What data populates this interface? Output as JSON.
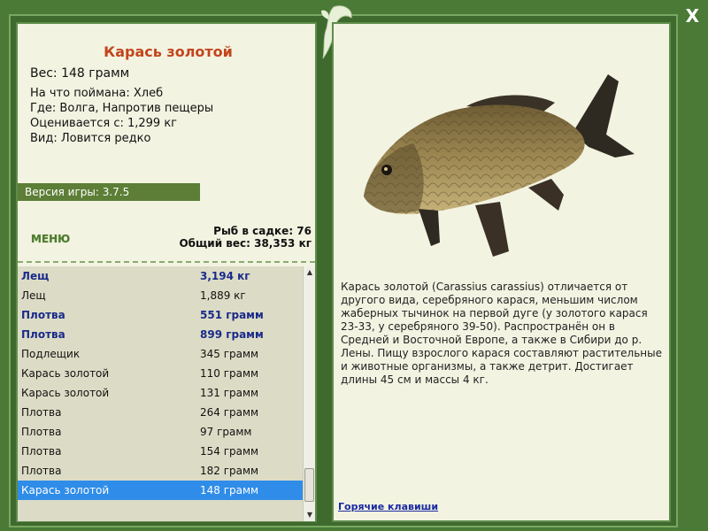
{
  "close_label": "X",
  "fish": {
    "title": "Карась золотой",
    "weight_line": "Вес: 148 грамм",
    "bait_line": "На что поймана: Хлеб",
    "place_line": "Где: Волга, Напротив пещеры",
    "price_line": "Оценивается с: 1,299 кг",
    "kind_line": "Вид: Ловится редко"
  },
  "version_label": "Версия игры: 3.7.5",
  "menu_label": "МЕНЮ",
  "cage": {
    "count_line": "Рыб в садке: 76",
    "total_line": "Общий вес: 38,353 кг"
  },
  "catch_list": [
    {
      "name": "Лещ",
      "weight": "3,194 кг",
      "bold": true
    },
    {
      "name": "Лещ",
      "weight": "1,889 кг",
      "bold": false
    },
    {
      "name": "Плотва",
      "weight": "551 грамм",
      "bold": true
    },
    {
      "name": "Плотва",
      "weight": "899 грамм",
      "bold": true
    },
    {
      "name": "Подлещик",
      "weight": "345 грамм",
      "bold": false
    },
    {
      "name": "Карась золотой",
      "weight": "110 грамм",
      "bold": false
    },
    {
      "name": "Карась золотой",
      "weight": "131 грамм",
      "bold": false
    },
    {
      "name": "Плотва",
      "weight": "264 грамм",
      "bold": false
    },
    {
      "name": "Плотва",
      "weight": "97 грамм",
      "bold": false
    },
    {
      "name": "Плотва",
      "weight": "154 грамм",
      "bold": false
    },
    {
      "name": "Плотва",
      "weight": "182 грамм",
      "bold": false
    },
    {
      "name": "Карась золотой",
      "weight": "148 грамм",
      "bold": false,
      "selected": true
    }
  ],
  "description": "Карась золотой (Carassius carassius) отличается от другого вида, серебряного карася, меньшим числом жаберных тычинок на первой дуге (у золотого карася 23-33, у серебряного 39-50). Распространён он в Средней и Восточной Европе, а также в Сибири до р. Лены. Пищу взрослого карася составляют растительные и животные организмы, а также детрит. Достигает длины 45 см и массы 4 кг.",
  "hotkeys_label": "Горячие клавиши",
  "colors": {
    "frame": "#4a7a35",
    "panel": "#f3f3e2",
    "title": "#c2451b",
    "list_bg": "#dcdcc6",
    "selected": "#2f8ce8",
    "bold_row": "#1a2a8a"
  }
}
